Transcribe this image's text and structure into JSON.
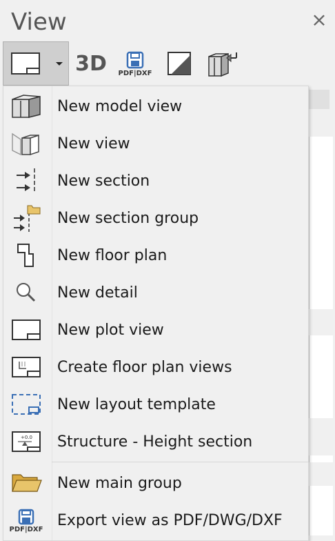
{
  "panel": {
    "title": "View",
    "close_symbol": "×"
  },
  "toolbar": {
    "dropdown_icon": "plot-view-icon",
    "btn_3d_label": "3D",
    "btn_pdf_label": "PDF|DXF"
  },
  "menu": {
    "items": [
      {
        "label": "New model view",
        "icon": "model-view-icon"
      },
      {
        "label": "New view",
        "icon": "new-view-icon"
      },
      {
        "label": "New section",
        "icon": "section-arrows-icon"
      },
      {
        "label": "New section group",
        "icon": "section-group-icon"
      },
      {
        "label": "New floor plan",
        "icon": "floor-plan-icon"
      },
      {
        "label": "New detail",
        "icon": "magnifier-icon"
      },
      {
        "label": "New plot view",
        "icon": "plot-view-icon"
      },
      {
        "label": "Create floor plan views",
        "icon": "floor-plan-views-icon"
      },
      {
        "label": "New layout template",
        "icon": "layout-template-icon"
      },
      {
        "label": "Structure - Height section",
        "icon": "height-section-icon"
      },
      {
        "label": "New main group",
        "icon": "folder-icon"
      },
      {
        "label": "Export view as PDF/DWG/DXF",
        "icon": "export-pdf-icon"
      }
    ],
    "export_icon_text": "PDF|DXF"
  },
  "colors": {
    "folder": "#e8c46a",
    "icon_blue": "#3a6fb5",
    "icon_grey": "#444444"
  }
}
